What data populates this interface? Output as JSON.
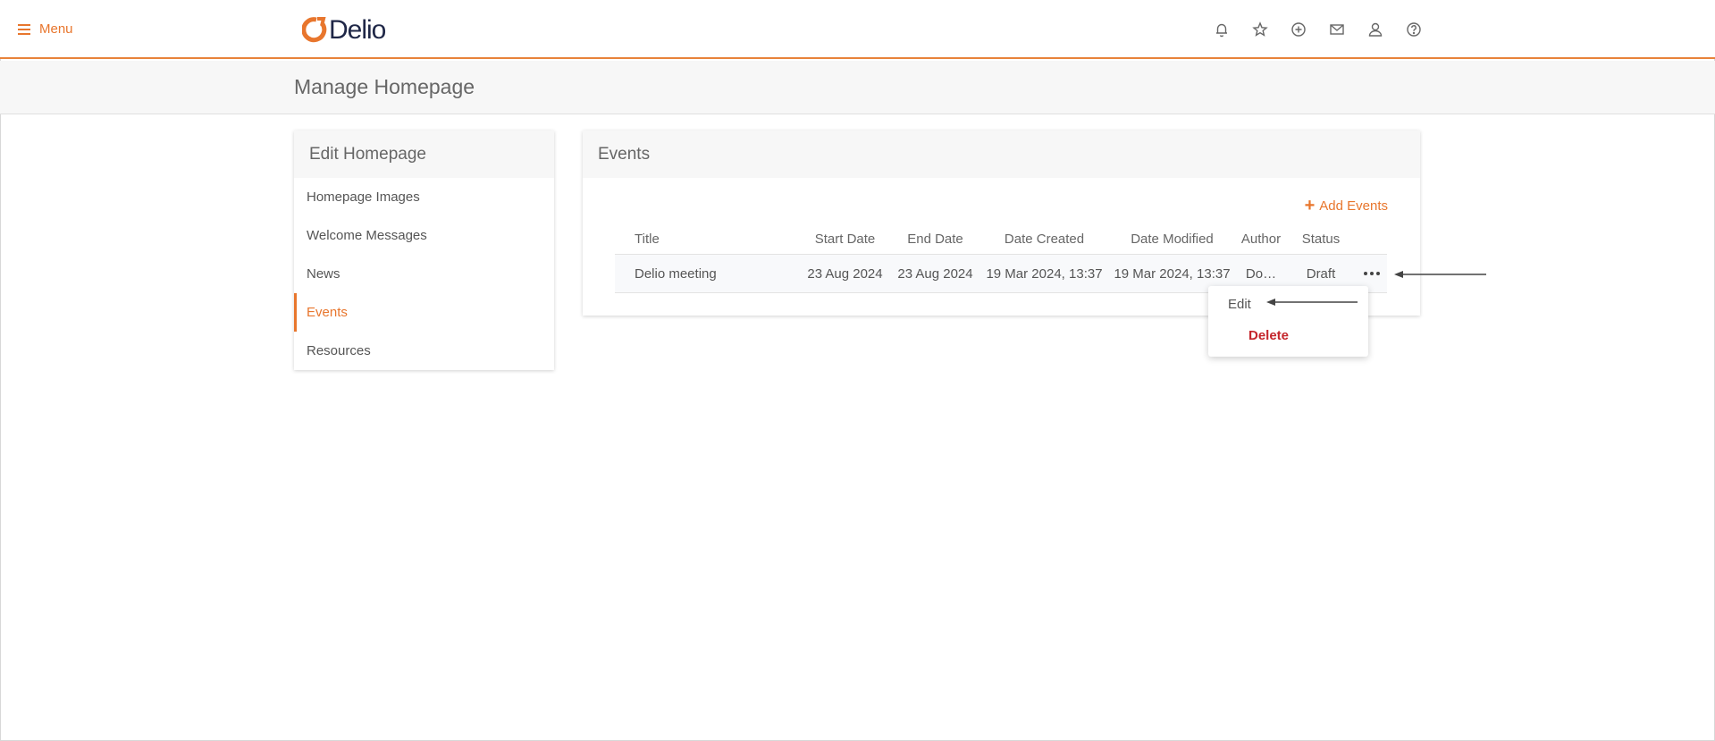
{
  "topbar": {
    "menu_label": "Menu",
    "logo_text": "Delio",
    "icons": [
      "bell-icon",
      "star-icon",
      "plus-circle-icon",
      "mail-icon",
      "user-icon",
      "help-icon"
    ],
    "accent_color": "#e8762d"
  },
  "page": {
    "title": "Manage Homepage"
  },
  "sidebar": {
    "heading": "Edit Homepage",
    "items": [
      {
        "label": "Homepage Images",
        "active": false
      },
      {
        "label": "Welcome Messages",
        "active": false
      },
      {
        "label": "News",
        "active": false
      },
      {
        "label": "Events",
        "active": true
      },
      {
        "label": "Resources",
        "active": false
      }
    ]
  },
  "events": {
    "heading": "Events",
    "add_label": "Add Events",
    "columns": [
      "Title",
      "Start Date",
      "End Date",
      "Date Created",
      "Date Modified",
      "Author",
      "Status"
    ],
    "rows": [
      {
        "title": "Delio meeting",
        "start_date": "23 Aug 2024",
        "end_date": "23 Aug 2024",
        "date_created": "19 Mar 2024, 13:37",
        "date_modified": "19 Mar 2024, 13:37",
        "author": "Do…",
        "status": "Draft"
      }
    ]
  },
  "row_menu": {
    "edit_label": "Edit",
    "delete_label": "Delete",
    "delete_color": "#c4252b"
  }
}
